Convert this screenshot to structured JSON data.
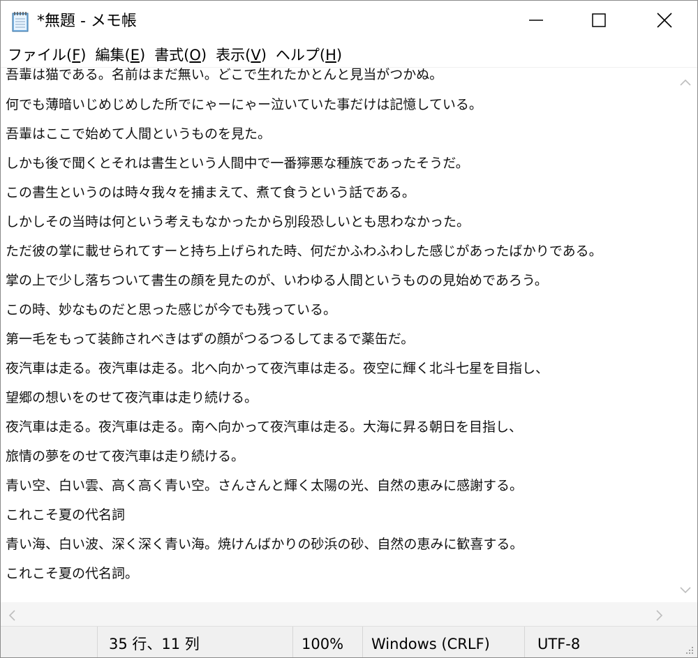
{
  "window": {
    "title": "*無題 - メモ帳",
    "app_icon": "notepad-icon",
    "controls": [
      "minimize-icon",
      "maximize-icon",
      "close-icon"
    ]
  },
  "menu": [
    {
      "label": "ファイル(",
      "key": "F",
      "end": ")"
    },
    {
      "label": "編集(",
      "key": "E",
      "end": ")"
    },
    {
      "label": "書式(",
      "key": "O",
      "end": ")"
    },
    {
      "label": "表示(",
      "key": "V",
      "end": ")"
    },
    {
      "label": "ヘルプ(",
      "key": "H",
      "end": ")"
    }
  ],
  "editor": {
    "lines": [
      "吾輩は猫である。名前はまだ無い。どこで生れたかとんと見当がつかぬ。",
      "何でも薄暗いじめじめした所でにゃーにゃー泣いていた事だけは記憶している。",
      "吾輩はここで始めて人間というものを見た。",
      "しかも後で聞くとそれは書生という人間中で一番獰悪な種族であったそうだ。",
      "この書生というのは時々我々を捕まえて、煮て食うという話である。",
      "しかしその当時は何という考えもなかったから別段恐しいとも思わなかった。",
      "ただ彼の掌に載せられてすーと持ち上げられた時、何だかふわふわした感じがあったばかりである。",
      "掌の上で少し落ちついて書生の顔を見たのが、いわゆる人間というものの見始めであろう。",
      "この時、妙なものだと思った感じが今でも残っている。",
      "第一毛をもって装飾されべきはずの顔がつるつるしてまるで薬缶だ。",
      "夜汽車は走る。夜汽車は走る。北へ向かって夜汽車は走る。夜空に輝く北斗七星を目指し、",
      "望郷の想いをのせて夜汽車は走り続ける。",
      "夜汽車は走る。夜汽車は走る。南へ向かって夜汽車は走る。大海に昇る朝日を目指し、",
      "旅情の夢をのせて夜汽車は走り続ける。",
      "青い空、白い雲、高く高く青い空。さんさんと輝く太陽の光、自然の恵みに感謝する。",
      "これこそ夏の代名詞",
      "青い海、白い波、深く深く青い海。焼けんばかりの砂浜の砂、自然の恵みに歓喜する。",
      "これこそ夏の代名詞。"
    ]
  },
  "status": {
    "position": "35 行、11 列",
    "zoom": "100%",
    "line_ending": "Windows (CRLF)",
    "encoding": "UTF-8"
  }
}
